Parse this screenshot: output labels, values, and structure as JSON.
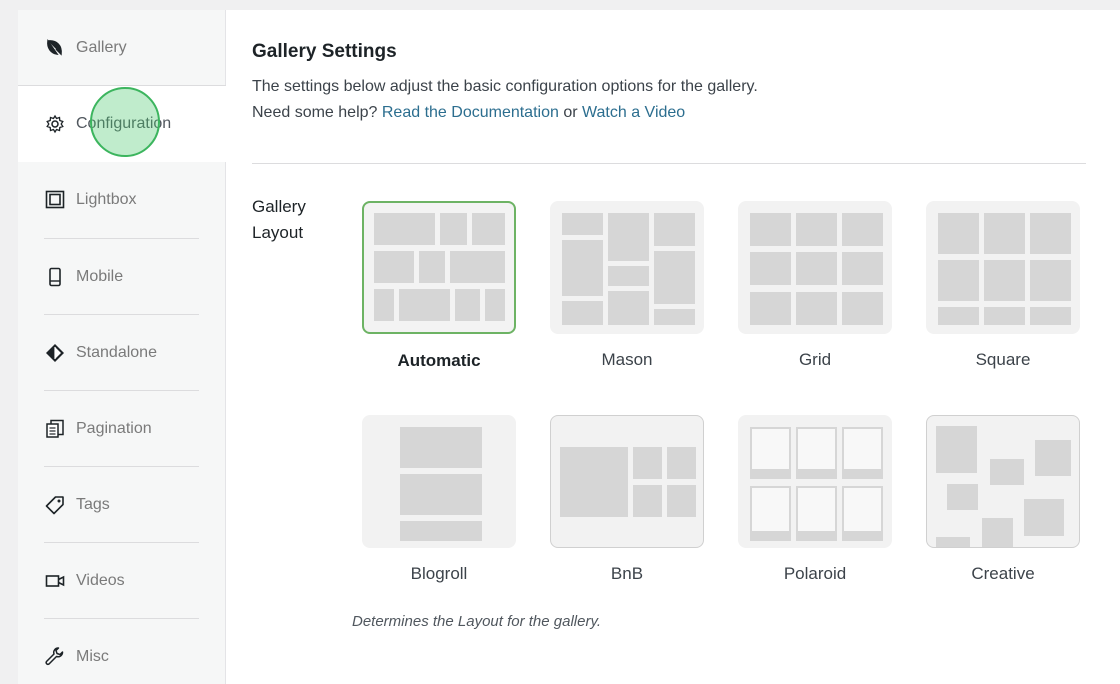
{
  "sidebar": {
    "items": [
      {
        "label": "Gallery",
        "icon": "leaf-icon"
      },
      {
        "label": "Configuration",
        "icon": "gear-icon",
        "active": true
      },
      {
        "label": "Lightbox",
        "icon": "lightbox-icon"
      },
      {
        "label": "Mobile",
        "icon": "mobile-icon"
      },
      {
        "label": "Standalone",
        "icon": "standalone-icon"
      },
      {
        "label": "Pagination",
        "icon": "pagination-icon"
      },
      {
        "label": "Tags",
        "icon": "tag-icon"
      },
      {
        "label": "Videos",
        "icon": "video-icon"
      },
      {
        "label": "Misc",
        "icon": "wrench-icon"
      }
    ]
  },
  "main": {
    "title": "Gallery Settings",
    "description_line1": "The settings below adjust the basic configuration options for the gallery.",
    "help_prefix": "Need some help?",
    "doc_link": "Read the Documentation",
    "or_text": "or",
    "video_link": "Watch a Video",
    "layout_field_label": "Gallery Layout",
    "layouts": [
      {
        "name": "Automatic",
        "selected": true
      },
      {
        "name": "Mason"
      },
      {
        "name": "Grid"
      },
      {
        "name": "Square"
      },
      {
        "name": "Blogroll"
      },
      {
        "name": "BnB"
      },
      {
        "name": "Polaroid"
      },
      {
        "name": "Creative"
      }
    ],
    "help_text": "Determines the Layout for the gallery."
  },
  "colors": {
    "accent_link": "#2c6e8f",
    "selected_border": "#6db364",
    "cursor_highlight": "#3cb55e"
  }
}
